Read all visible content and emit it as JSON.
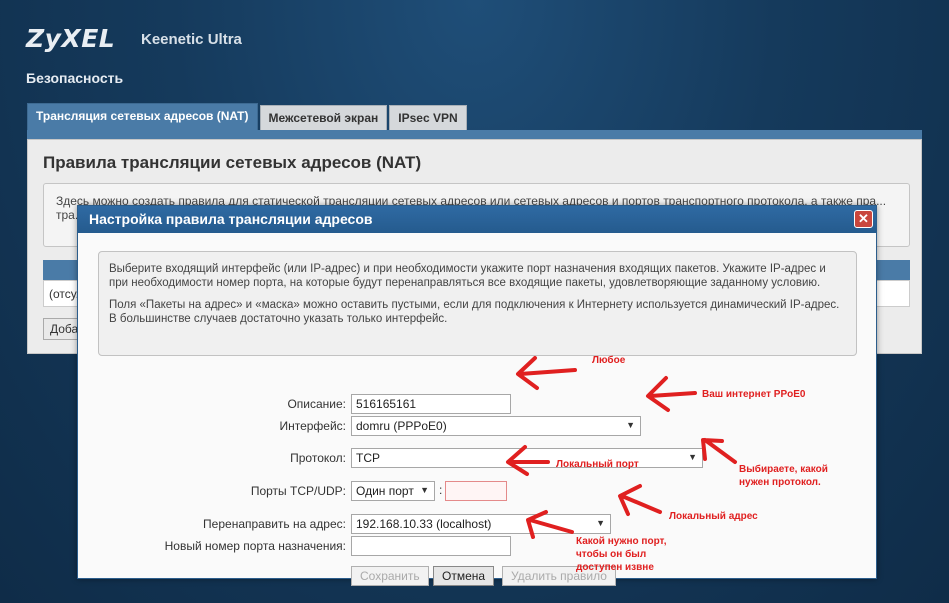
{
  "header": {
    "brand": "ZyXEL",
    "model": "Keenetic Ultra",
    "section": "Безопасность"
  },
  "tabs": [
    {
      "label": "Трансляция сетевых адресов (NAT)",
      "active": true
    },
    {
      "label": "Межсетевой экран",
      "active": false
    },
    {
      "label": "IPsec VPN",
      "active": false
    }
  ],
  "panel": {
    "title": "Правила трансляции сетевых адресов (NAT)",
    "info": "Здесь можно создать правила для статической трансляции сетевых адресов или сетевых адресов и портов транспортного протокола, а также пра... тра...",
    "row": "(отсу...",
    "add": "Доба..."
  },
  "modal": {
    "title": "Настройка правила трансляции адресов",
    "close": "✕",
    "notice1": "Выберите входящий интерфейс (или IP-адрес) и при необходимости укажите порт назначения входящих пакетов. Укажите IP-адрес и при необходимости номер порта, на которые будут перенаправляться все входящие пакеты, удовлетворяющие заданному условию.",
    "notice2": "Поля «Пакеты на адрес» и «маска» можно оставить пустыми, если для подключения к Интернету используется динамический IP-адрес. В большинстве случаев достаточно указать только интерфейс.",
    "fields": {
      "description_label": "Описание:",
      "description_value": "516165161",
      "interface_label": "Интерфейс:",
      "interface_value": "domru (PPPoE0)",
      "protocol_label": "Протокол:",
      "protocol_value": "TCP",
      "ports_label": "Порты TCP/UDP:",
      "ports_value": "Один порт",
      "redirect_label": "Перенаправить на адрес:",
      "redirect_value": "192.168.10.33 (localhost)",
      "newport_label": "Новый номер порта назначения:",
      "newport_value": ""
    },
    "buttons": {
      "save": "Сохранить",
      "cancel": "Отмена",
      "delete": "Удалить правило"
    }
  },
  "annotations": {
    "a1": "Любое",
    "a2": "Ваш интернет PPoE0",
    "a3": "Локальный порт",
    "a4": "Выбираете, какой нужен протокол.",
    "a5": "Локальный адрес",
    "a6": "Какой нужно порт, чтобы он был доступен извне"
  },
  "colors": {
    "annotation": "#e02020",
    "accent": "#4a7ba7",
    "titlebar": "#2b639b"
  }
}
